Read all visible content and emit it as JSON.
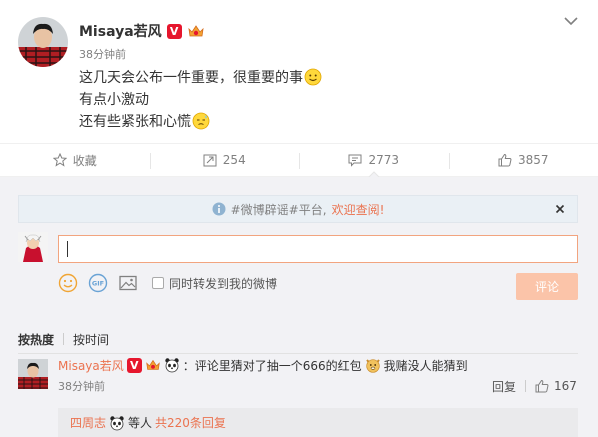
{
  "post": {
    "author": "Misaya若风",
    "verified_badge": "V",
    "time": "38分钟前",
    "lines": [
      "这几天会公布一件重要，很重要的事",
      "有点小激动",
      "还有些紧张和心慌"
    ],
    "line_emojis": [
      "smile-emoji",
      "none",
      "sweat-emoji"
    ]
  },
  "actions": {
    "favorite": {
      "label": "收藏",
      "icon": "star-icon"
    },
    "repost": {
      "count": "254",
      "icon": "repost-icon"
    },
    "comment": {
      "count": "2773",
      "icon": "comment-icon"
    },
    "like": {
      "count": "3857",
      "icon": "thumbs-up-icon"
    }
  },
  "comment_box": {
    "notice_text": "#微博辟谣#平台,",
    "notice_link": "欢迎查阅!",
    "input_value": "",
    "forward_label": "同时转发到我的微博",
    "submit_label": "评论"
  },
  "sort": {
    "active": "按热度",
    "other": "按时间"
  },
  "top_comment": {
    "author": "Misaya若风",
    "text_part1": "：评论里猜对了抽一个666的红包",
    "text_part2": "我赌没人能猜到",
    "time": "38分钟前",
    "reply_label": "回复",
    "like_count": "167"
  },
  "sub_reply": {
    "author": "四周志",
    "text": "等人",
    "count_text": "共220条回复"
  },
  "colors": {
    "accent": "#eb7350",
    "verified_red": "#e6162d",
    "submit_disabled": "#fbc4a9",
    "panel_bg": "#f2f2f5"
  }
}
